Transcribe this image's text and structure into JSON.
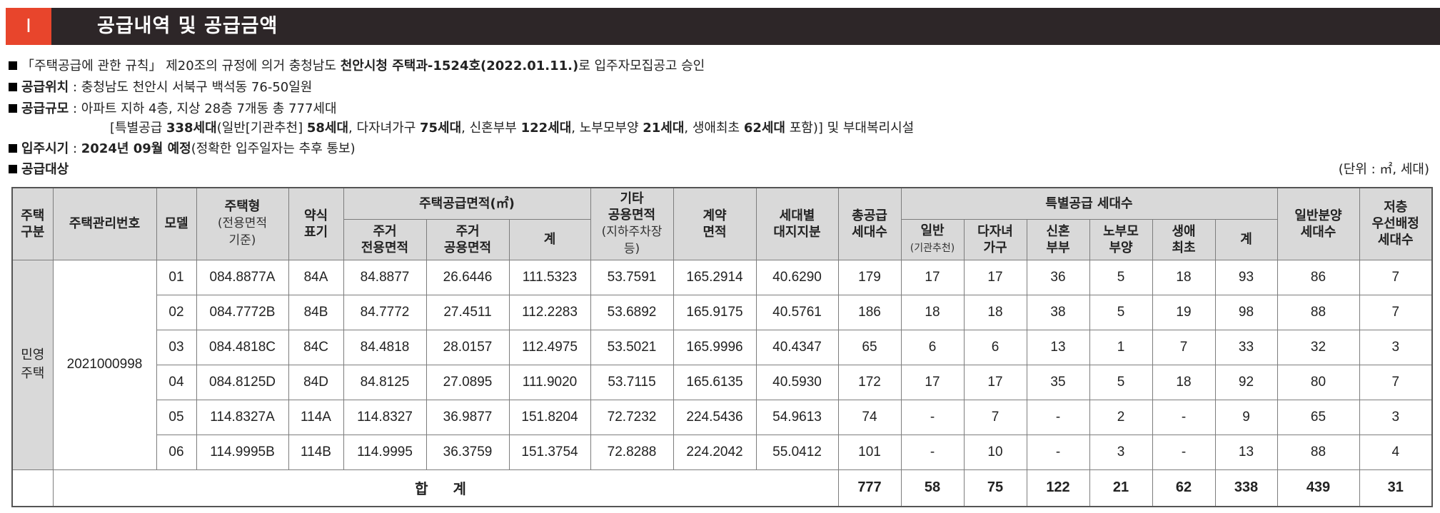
{
  "header": {
    "number": "I",
    "title": "공급내역 및 공급금액"
  },
  "info": {
    "line1_pre": "「주택공급에 관한 규칙」 제20조의 규정에 의거 충청남도 ",
    "line1_bold": "천안시청 주택과-1524호(2022.01.11.)",
    "line1_post": "로 입주자모집공고 승인",
    "location_label": "공급위치",
    "location_value": " : 충청남도 천안시 서북구 백석동 76-50일원",
    "scale_label": "공급규모",
    "scale_value": " : 아파트 지하 4층, 지상 28층 7개동 총 777세대",
    "scale_line2": {
      "t1": "[특별공급 ",
      "b1": "338세대",
      "t2": "(일반[기관추천] ",
      "b2": "58세대",
      "t3": ", 다자녀가구 ",
      "b3": "75세대",
      "t4": ", 신혼부부 ",
      "b4": "122세대",
      "t5": ", 노부모부양 ",
      "b5": "21세대",
      "t6": ", 생애최초 ",
      "b6": "62세대",
      "t7": " 포함)] 및 부대복리시설"
    },
    "movein_label": "입주시기",
    "movein_value_pre": " : ",
    "movein_value_bold": "2024년 09월 예정",
    "movein_value_post": "(정확한 입주일자는 추후 통보)",
    "target_label": "공급대상",
    "unit": "(단위 : ㎡, 세대)"
  },
  "table": {
    "headers": {
      "housing_type_1": "주택",
      "housing_type_2": "구분",
      "mgmt_no": "주택관리번호",
      "model": "모델",
      "house_type_1": "주택형",
      "house_type_2": "(전용면적",
      "house_type_3": "기준)",
      "short_1": "약식",
      "short_2": "표기",
      "supply_area": "주택공급면적(㎡)",
      "res_excl_1": "주거",
      "res_excl_2": "전용면적",
      "res_common_1": "주거",
      "res_common_2": "공용면적",
      "area_sum": "계",
      "other_1": "기타",
      "other_2": "공용면적",
      "other_3": "(지하주차장",
      "other_4": "등)",
      "contract_1": "계약",
      "contract_2": "면적",
      "land_1": "세대별",
      "land_2": "대지지분",
      "total_supply_1": "총공급",
      "total_supply_2": "세대수",
      "special": "특별공급 세대수",
      "sp_general_1": "일반",
      "sp_general_2": "(기관추천)",
      "sp_multi_1": "다자녀",
      "sp_multi_2": "가구",
      "sp_newlywed_1": "신혼",
      "sp_newlywed_2": "부부",
      "sp_elder_1": "노부모",
      "sp_elder_2": "부양",
      "sp_first_1": "생애",
      "sp_first_2": "최초",
      "sp_sum": "계",
      "general_1": "일반분양",
      "general_2": "세대수",
      "low_1": "저층",
      "low_2": "우선배정",
      "low_3": "세대수"
    },
    "group_label_1": "민영",
    "group_label_2": "주택",
    "mgmt_number": "2021000998",
    "rows": [
      [
        "01",
        "084.8877A",
        "84A",
        "84.8877",
        "26.6446",
        "111.5323",
        "53.7591",
        "165.2914",
        "40.6290",
        "179",
        "17",
        "17",
        "36",
        "5",
        "18",
        "93",
        "86",
        "7"
      ],
      [
        "02",
        "084.7772B",
        "84B",
        "84.7772",
        "27.4511",
        "112.2283",
        "53.6892",
        "165.9175",
        "40.5761",
        "186",
        "18",
        "18",
        "38",
        "5",
        "19",
        "98",
        "88",
        "7"
      ],
      [
        "03",
        "084.4818C",
        "84C",
        "84.4818",
        "28.0157",
        "112.4975",
        "53.5021",
        "165.9996",
        "40.4347",
        "65",
        "6",
        "6",
        "13",
        "1",
        "7",
        "33",
        "32",
        "3"
      ],
      [
        "04",
        "084.8125D",
        "84D",
        "84.8125",
        "27.0895",
        "111.9020",
        "53.7115",
        "165.6135",
        "40.5930",
        "172",
        "17",
        "17",
        "35",
        "5",
        "18",
        "92",
        "80",
        "7"
      ],
      [
        "05",
        "114.8327A",
        "114A",
        "114.8327",
        "36.9877",
        "151.8204",
        "72.7232",
        "224.5436",
        "54.9613",
        "74",
        "-",
        "7",
        "-",
        "2",
        "-",
        "9",
        "65",
        "3"
      ],
      [
        "06",
        "114.9995B",
        "114B",
        "114.9995",
        "36.3759",
        "151.3754",
        "72.8288",
        "224.2042",
        "55.0412",
        "101",
        "-",
        "10",
        "-",
        "3",
        "-",
        "13",
        "88",
        "4"
      ]
    ],
    "total_label": "합 계",
    "totals": [
      "777",
      "58",
      "75",
      "122",
      "21",
      "62",
      "338",
      "439",
      "31"
    ]
  },
  "colors": {
    "header_bg": "#2d2628",
    "header_accent": "#e8452c",
    "table_header_bg": "#d9d9d9"
  }
}
